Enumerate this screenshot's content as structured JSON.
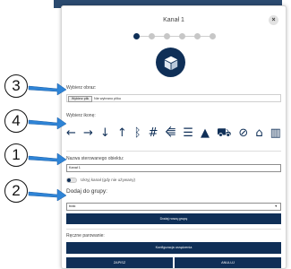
{
  "modal": {
    "title": "Kanał 1",
    "close_label": "×",
    "steps_count": 6,
    "active_step": 1
  },
  "image_section": {
    "label": "Wybierz obraz:",
    "file_button": "Wybierz plik",
    "file_status": "Nie wybrano pliku"
  },
  "icon_section": {
    "label": "Wybierz ikonę:",
    "icons": [
      {
        "name": "arrow-left-icon",
        "glyph": "←"
      },
      {
        "name": "arrow-right-icon",
        "glyph": "→"
      },
      {
        "name": "arrow-down-icon",
        "glyph": "↓"
      },
      {
        "name": "arrow-up-icon",
        "glyph": "↑"
      },
      {
        "name": "bluetooth-icon",
        "glyph": "ᛒ"
      },
      {
        "name": "hashtag-icon",
        "glyph": "#"
      },
      {
        "name": "usb-icon",
        "glyph": "⭅"
      },
      {
        "name": "menu-bars-icon",
        "glyph": "☰"
      },
      {
        "name": "area-chart-icon",
        "glyph": "▲"
      },
      {
        "name": "car-icon",
        "glyph": "⛟"
      },
      {
        "name": "ban-icon",
        "glyph": "⊘"
      },
      {
        "name": "bank-icon",
        "glyph": "⌂"
      },
      {
        "name": "bar-chart-icon",
        "glyph": "▥"
      }
    ]
  },
  "name_section": {
    "label": "Nazwa sterowanego obiektu:",
    "value": "Kanał 1",
    "hide_toggle_label": "Ukryj kanał (gdy nie używany)"
  },
  "group_section": {
    "label": "Dodaj do grupy:",
    "selected": "brak",
    "add_group_button": "Dodaj nową grupę"
  },
  "pairing_section": {
    "label": "Ręczne parowanie:",
    "config_button": "Konfiguracja urządzenia"
  },
  "footer": {
    "back_button": "ZAPISZ",
    "cancel_button": "ANULUJ"
  },
  "annotations": {
    "badge_3": "3",
    "badge_4": "4",
    "badge_1": "1",
    "badge_2": "2",
    "arrow_color": "#2f84d6"
  },
  "colors": {
    "accent": "#0f2f57",
    "band": "#2b4a6f",
    "arrow": "#2f84d6"
  }
}
